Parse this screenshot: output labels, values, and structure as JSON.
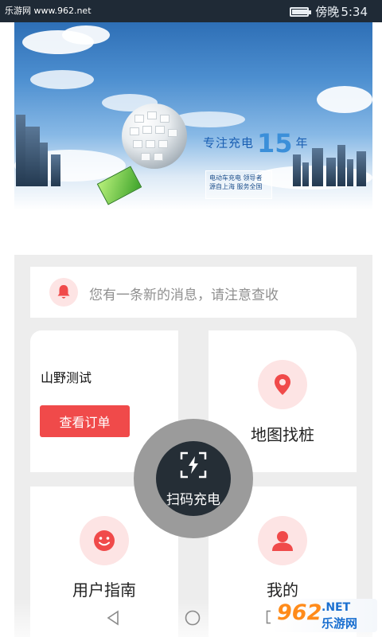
{
  "status_bar": {
    "watermark": "乐游网 www.962.net",
    "carrier": "傍晚",
    "time": "5:34",
    "battery_level": 0.85
  },
  "banner": {
    "slogan_prefix": "专注充电",
    "slogan_number": "15",
    "slogan_suffix": "年",
    "tagline_1": "电动车充电  领导者",
    "tagline_2": "源自上海  服务全国"
  },
  "notice": {
    "icon": "bell-icon",
    "text": "您有一条新的消息，请注意查收"
  },
  "user_card": {
    "name": "山野测试",
    "orders_button": "查看订单"
  },
  "menu": {
    "map": {
      "label": "地图找桩",
      "icon": "map-pin-icon"
    },
    "guide": {
      "label": "用户指南",
      "icon": "smile-icon"
    },
    "mine": {
      "label": "我的",
      "icon": "person-icon"
    }
  },
  "scan": {
    "label": "扫码充电",
    "icon": "scan-lightning-icon"
  },
  "nav": {
    "back_icon": "back-icon",
    "home_icon": "home-icon",
    "recent_icon": "recent-apps-icon"
  },
  "brand_badge": {
    "number": "962",
    "tld": ".NET",
    "site": "乐游网"
  },
  "colors": {
    "accent": "#f04a4a",
    "icon_bg": "#fde4e4",
    "status_bar": "#1f2a36",
    "scan_button": "#252e36"
  }
}
